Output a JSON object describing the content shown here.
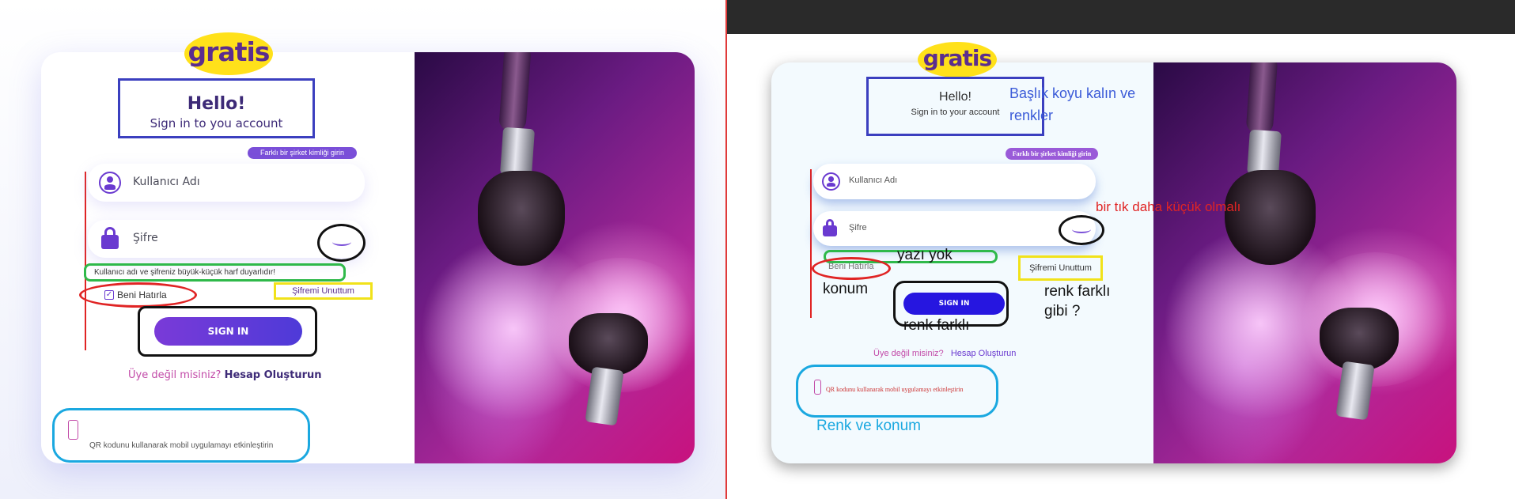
{
  "logo": {
    "text": "gratis"
  },
  "login": {
    "title": "Hello!",
    "subtitle_design": "Sign in to you account",
    "subtitle_impl": "Sign in to your account",
    "company_pill": "Farklı bir şirket kimliği girin",
    "username_placeholder": "Kullanıcı Adı",
    "password_placeholder": "Şifre",
    "case_hint": "Kullanıcı adı ve şifreniz büyük-küçük harf duyarlıdır!",
    "remember_me": "Beni Hatırla",
    "forgot_password": "Şifremi Unuttum",
    "sign_in": "SIGN IN",
    "register_question": "Üye değil misiniz?",
    "register_link": "Hesap Oluşturun",
    "qr_text": "QR kodunu kullanarak mobil uygulamayı etkinleştirin",
    "qr_text_impl": "QR kodunu kullanarak mobil uygulamayı etkinleştirin"
  },
  "annotations": {
    "title_note_line1": "Başlık koyu kalın ve",
    "title_note_line2": "renkler",
    "eye_note": "bir tık daha küçük olmalı",
    "hint_note": "yazı yok",
    "remember_note": "konum",
    "signin_note": "renk farklı",
    "forgot_note_line1": "renk farklı",
    "forgot_note_line2": "gibi ?",
    "qr_note": "Renk ve konum"
  },
  "colors": {
    "brand_yellow": "#ffe11a",
    "brand_purple": "#5b2d8e",
    "annot_blue": "#3b3fbf",
    "annot_green": "#2fb94a",
    "annot_red": "#e02424",
    "annot_yellow": "#f1e21a",
    "annot_cyan": "#1aa8e0"
  },
  "icons": {
    "user": "user-circle-icon",
    "lock": "lock-icon",
    "eye": "eye-closed-icon",
    "checkbox": "checkbox-checked-icon",
    "phone": "phone-hand-icon"
  }
}
